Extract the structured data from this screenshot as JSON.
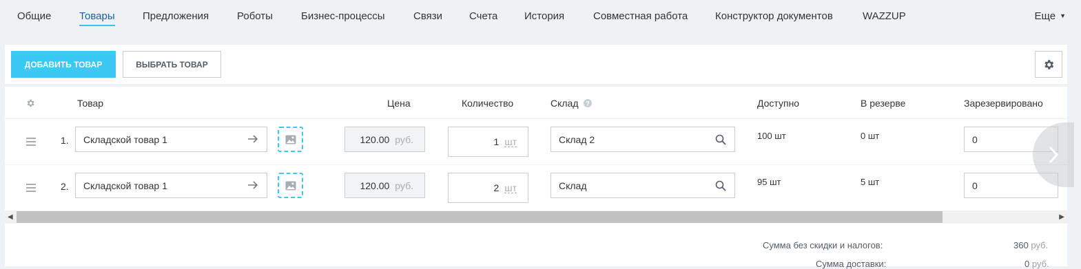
{
  "tabs": [
    {
      "label": "Общие"
    },
    {
      "label": "Товары"
    },
    {
      "label": "Предложения"
    },
    {
      "label": "Роботы"
    },
    {
      "label": "Бизнес-процессы"
    },
    {
      "label": "Связи"
    },
    {
      "label": "Счета"
    },
    {
      "label": "История"
    },
    {
      "label": "Совместная работа"
    },
    {
      "label": "Конструктор документов"
    },
    {
      "label": "WAZZUP"
    }
  ],
  "more_label": "Еще",
  "toolbar": {
    "add_label": "ДОБАВИТЬ ТОВАР",
    "select_label": "ВЫБРАТЬ ТОВАР"
  },
  "columns": {
    "product": "Товар",
    "price": "Цена",
    "quantity": "Количество",
    "store": "Склад",
    "available": "Доступно",
    "in_reserve": "В резерве",
    "reserved": "Зарезервировано"
  },
  "rows": [
    {
      "num": "1.",
      "product": "Складской товар 1",
      "price": "120.00",
      "currency": "руб.",
      "qty": "1",
      "unit": "шт",
      "store": "Склад 2",
      "available": "100 шт",
      "in_reserve": "0 шт",
      "reserved": "0"
    },
    {
      "num": "2.",
      "product": "Складской товар 1",
      "price": "120.00",
      "currency": "руб.",
      "qty": "2",
      "unit": "шт",
      "store": "Склад",
      "available": "95 шт",
      "in_reserve": "5 шт",
      "reserved": "0"
    }
  ],
  "totals": {
    "subtotal_label": "Сумма без скидки и налогов:",
    "subtotal_value": "360",
    "delivery_label": "Сумма доставки:",
    "delivery_value": "0",
    "currency": "руб."
  },
  "colors": {
    "accent": "#3bc8f5",
    "active_tab": "#1a5f9e",
    "background": "#eef2f4"
  },
  "icons": [
    "gear-icon",
    "arrow-right-icon",
    "image-icon",
    "search-icon",
    "help-icon",
    "drag-handle-icon",
    "chevron-right-icon",
    "chevron-down-icon"
  ]
}
